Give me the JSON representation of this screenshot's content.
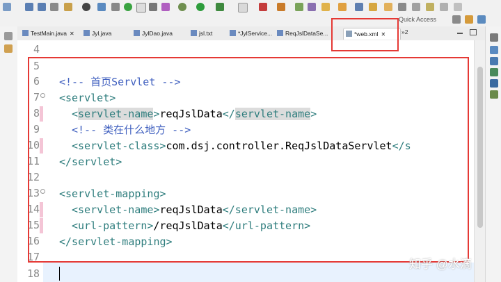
{
  "toolbar": {
    "quick_access": "Quick Access"
  },
  "tabs": [
    {
      "label": "TestMain.java",
      "close": "✕",
      "active": false
    },
    {
      "label": "Jyl.java",
      "close": "",
      "active": false
    },
    {
      "label": "JylDao.java",
      "close": "",
      "active": false
    },
    {
      "label": "jsl.txt",
      "close": "",
      "active": false
    },
    {
      "label": "*JylService...",
      "close": "",
      "active": false
    },
    {
      "label": "ReqJslDataSe...",
      "close": "",
      "active": false
    },
    {
      "label": "*web.xml",
      "close": "✕",
      "active": true
    }
  ],
  "tab_overflow": "»2",
  "editor": {
    "lines": [
      {
        "num": "4",
        "parts": []
      },
      {
        "num": "5",
        "parts": []
      },
      {
        "num": "6",
        "parts": [
          {
            "t": "<!-- 首页Servlet -->",
            "c": "com"
          }
        ]
      },
      {
        "num": "7",
        "parts": [
          {
            "t": "<servlet>",
            "c": "tag"
          }
        ]
      },
      {
        "num": "8",
        "parts": [
          {
            "t": "<",
            "c": "tag"
          },
          {
            "t": "servlet-name",
            "c": "tag sel"
          },
          {
            "t": ">",
            "c": "tag"
          },
          {
            "t": "reqJslData",
            "c": "txt"
          },
          {
            "t": "</",
            "c": "tag"
          },
          {
            "t": "servlet-name",
            "c": "tag sel"
          },
          {
            "t": ">",
            "c": "tag"
          }
        ]
      },
      {
        "num": "9",
        "parts": [
          {
            "t": "<!-- 类在什么地方 -->",
            "c": "com"
          }
        ]
      },
      {
        "num": "10",
        "parts": [
          {
            "t": "<servlet-class>",
            "c": "tag"
          },
          {
            "t": "com.dsj.controller.ReqJslDataServlet",
            "c": "txt"
          },
          {
            "t": "</s",
            "c": "tag"
          }
        ]
      },
      {
        "num": "11",
        "parts": [
          {
            "t": "</servlet>",
            "c": "tag"
          }
        ]
      },
      {
        "num": "12",
        "parts": []
      },
      {
        "num": "13",
        "parts": [
          {
            "t": "<servlet-mapping>",
            "c": "tag"
          }
        ]
      },
      {
        "num": "14",
        "parts": [
          {
            "t": "<servlet-name>",
            "c": "tag"
          },
          {
            "t": "reqJslData",
            "c": "txt"
          },
          {
            "t": "</servlet-name>",
            "c": "tag"
          }
        ]
      },
      {
        "num": "15",
        "parts": [
          {
            "t": "<url-pattern>",
            "c": "tag"
          },
          {
            "t": "/reqJslData",
            "c": "txt"
          },
          {
            "t": "</url-pattern>",
            "c": "tag"
          }
        ]
      },
      {
        "num": "16",
        "parts": [
          {
            "t": "</servlet-mapping>",
            "c": "tag"
          }
        ]
      },
      {
        "num": "17",
        "parts": []
      },
      {
        "num": "18",
        "parts": []
      }
    ]
  },
  "watermark": "知乎 @水滴",
  "colors": {
    "highlight_box": "#e53935",
    "tag": "#2e7d7d",
    "comment": "#3f5fbf"
  }
}
